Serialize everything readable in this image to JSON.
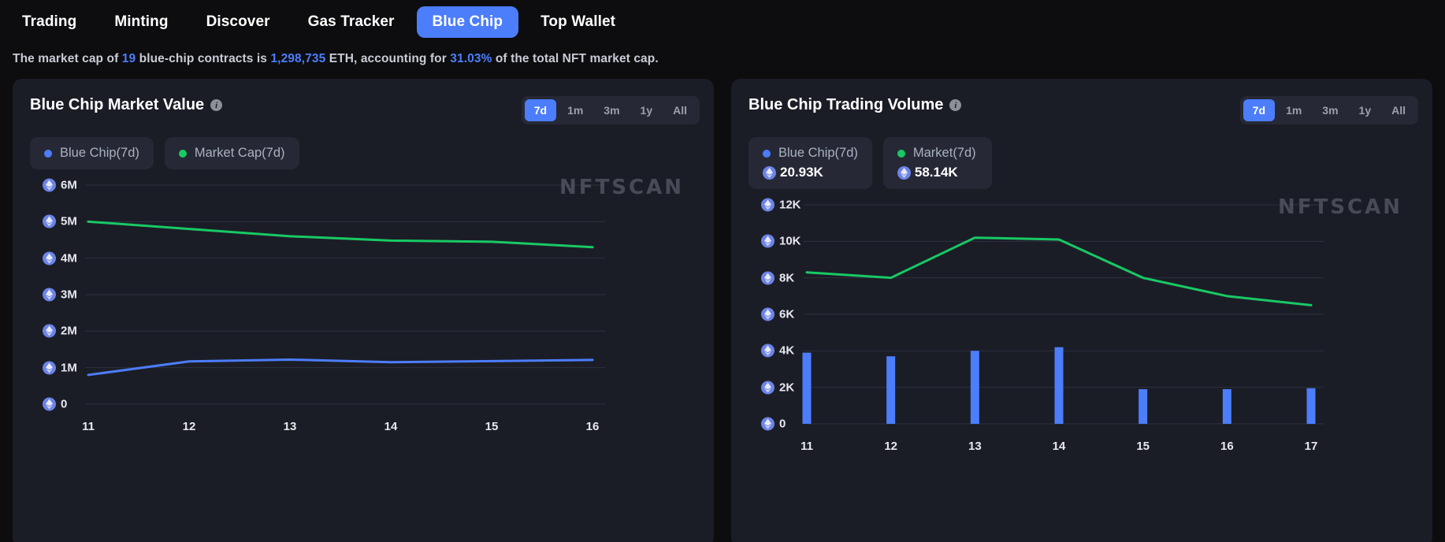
{
  "nav": {
    "items": [
      {
        "label": "Trading",
        "active": false
      },
      {
        "label": "Minting",
        "active": false
      },
      {
        "label": "Discover",
        "active": false
      },
      {
        "label": "Gas Tracker",
        "active": false
      },
      {
        "label": "Blue Chip",
        "active": true
      },
      {
        "label": "Top Wallet",
        "active": false
      }
    ]
  },
  "summary": {
    "part1": "The market cap of ",
    "count": "19",
    "part2": " blue-chip contracts is ",
    "market_cap": "1,298,735",
    "part3": " ETH, accounting for ",
    "percent": "31.03%",
    "part4": " of the total NFT market cap."
  },
  "colors": {
    "accent_blue": "#4c7dfb",
    "series_blue": "#4c7dfb",
    "series_green": "#18c964",
    "card_bg": "#1b1d26",
    "page_bg": "#0d0d0f"
  },
  "watermark": "NFTSCAN",
  "left_card": {
    "title": "Blue Chip Market Value",
    "info_icon": "info-icon",
    "ranges": [
      {
        "label": "7d",
        "active": true
      },
      {
        "label": "1m",
        "active": false
      },
      {
        "label": "3m",
        "active": false
      },
      {
        "label": "1y",
        "active": false
      },
      {
        "label": "All",
        "active": false
      }
    ],
    "legends": [
      {
        "label": "Blue Chip(7d)",
        "color": "#4c7dfb",
        "value": null
      },
      {
        "label": "Market Cap(7d)",
        "color": "#18c964",
        "value": null
      }
    ]
  },
  "right_card": {
    "title": "Blue Chip Trading Volume",
    "info_icon": "info-icon",
    "ranges": [
      {
        "label": "7d",
        "active": true
      },
      {
        "label": "1m",
        "active": false
      },
      {
        "label": "3m",
        "active": false
      },
      {
        "label": "1y",
        "active": false
      },
      {
        "label": "All",
        "active": false
      }
    ],
    "legends": [
      {
        "label": "Blue Chip(7d)",
        "color": "#4c7dfb",
        "value": "20.93K"
      },
      {
        "label": "Market(7d)",
        "color": "#18c964",
        "value": "58.14K"
      }
    ]
  },
  "chart_data": [
    {
      "type": "line",
      "title": "Blue Chip Market Value",
      "xlabel": "",
      "ylabel": "ETH",
      "categories": [
        "11",
        "12",
        "13",
        "14",
        "15",
        "16"
      ],
      "x_ticks": [
        "11",
        "12",
        "13",
        "14",
        "15",
        "16"
      ],
      "y_ticks": [
        "0",
        "1M",
        "2M",
        "3M",
        "4M",
        "5M",
        "6M"
      ],
      "y_tick_values": [
        0,
        1000000,
        2000000,
        3000000,
        4000000,
        5000000,
        6000000
      ],
      "ylim": [
        0,
        6000000
      ],
      "grid": true,
      "legend_position": "top-left",
      "series": [
        {
          "name": "Blue Chip(7d)",
          "color": "#4c7dfb",
          "values": [
            800000,
            1170000,
            1220000,
            1150000,
            1180000,
            1210000
          ]
        },
        {
          "name": "Market Cap(7d)",
          "color": "#18c964",
          "values": [
            5000000,
            4800000,
            4600000,
            4480000,
            4450000,
            4300000
          ]
        }
      ]
    },
    {
      "type": "bar",
      "title": "Blue Chip Trading Volume",
      "xlabel": "",
      "ylabel": "ETH",
      "categories": [
        "11",
        "12",
        "13",
        "14",
        "15",
        "16",
        "17"
      ],
      "x_ticks": [
        "11",
        "12",
        "13",
        "14",
        "15",
        "16",
        "17"
      ],
      "y_ticks": [
        "0",
        "2K",
        "4K",
        "6K",
        "8K",
        "10K",
        "12K"
      ],
      "y_tick_values": [
        0,
        2000,
        4000,
        6000,
        8000,
        10000,
        12000
      ],
      "ylim": [
        0,
        12000
      ],
      "grid": true,
      "legend_position": "top-left",
      "series": [
        {
          "name": "Blue Chip(7d)",
          "type": "bar",
          "color": "#4c7dfb",
          "values": [
            3900,
            3700,
            4000,
            4200,
            1900,
            1900,
            1950
          ]
        },
        {
          "name": "Market(7d)",
          "type": "line",
          "color": "#18c964",
          "values": [
            8300,
            8000,
            10200,
            10100,
            8000,
            7000,
            6500
          ]
        }
      ]
    }
  ]
}
